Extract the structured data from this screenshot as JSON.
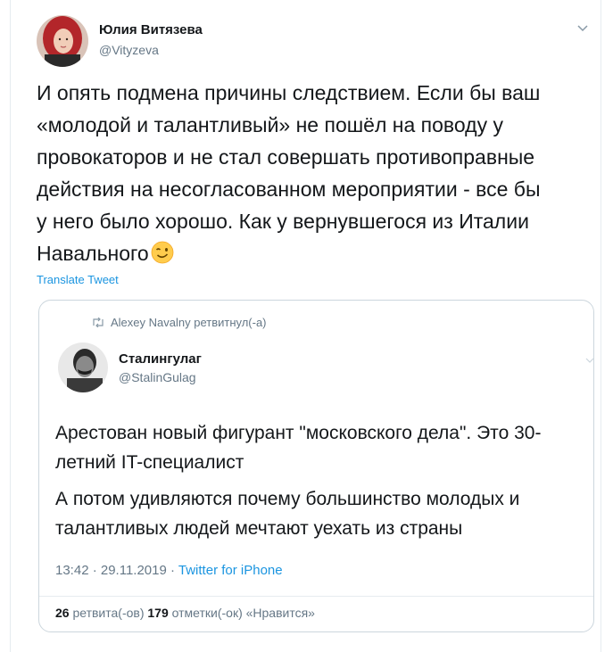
{
  "tweet": {
    "author_name": "Юлия Витязева",
    "author_handle": "@Vityzeva",
    "avatar_icon": "avatar-red-hair",
    "menu_icon": "chevron-down-icon",
    "text": "И опять подмена причины следствием. Если бы ваш\n«молодой и талантливый» не пошёл на поводу у\nпровокаторов и не стал совершать противоправные\nдействия на несогласованном мероприятии - все бы\nу него было хорошо. Как у вернувшегося из Италии\nНавального",
    "emoji_icon": "winking-face-emoji",
    "translate_label": "Translate Tweet"
  },
  "quoted": {
    "retweet_icon": "retweet-icon",
    "retweet_by": "Alexey Navalny ретвитнул(-а)",
    "author_name": "Сталингулаг",
    "author_handle": "@StalinGulag",
    "avatar_icon": "avatar-bw-portrait",
    "text_1": "Арестован новый фигурант \"московского дела\". Это 30-летний IT-специалист",
    "text_2": "А потом удивляются почему большинство молодых и талантливых людей мечтают уехать из страны",
    "time_date": "13:42 · 29.11.2019 · ",
    "source": "Twitter for iPhone",
    "retweets_count": "26",
    "retweets_label": " ретвита(-ов) ",
    "likes_count": "179",
    "likes_label": " отметки(-ок) «Нравится»"
  },
  "colors": {
    "text": "#14171a",
    "muted": "#657786",
    "link": "#1b95e0",
    "border": "#ccd6dd"
  }
}
